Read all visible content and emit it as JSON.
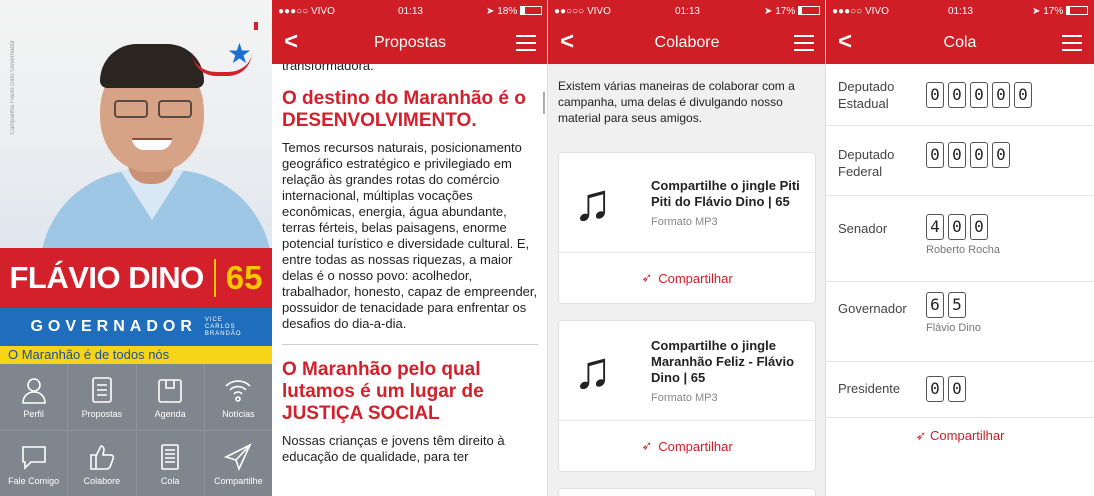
{
  "home": {
    "vertical_note": "Campanha Flávio Dino Governador",
    "name": "FLÁVIO DINO",
    "number": "65",
    "office": "GOVERNADOR",
    "vice_lines": [
      "VICE",
      "CARLOS",
      "BRANDÃO"
    ],
    "slogan": "O Maranhão é de todos nós",
    "menu": [
      {
        "label": "Perfil",
        "icon": "person-icon"
      },
      {
        "label": "Propostas",
        "icon": "document-icon"
      },
      {
        "label": "Agenda",
        "icon": "calendar-icon"
      },
      {
        "label": "Notícias",
        "icon": "wifi-icon"
      },
      {
        "label": "Fale Comigo",
        "icon": "chat-icon"
      },
      {
        "label": "Colabore",
        "icon": "thumbs-up-icon"
      },
      {
        "label": "Cola",
        "icon": "list-icon"
      },
      {
        "label": "Compartilhe",
        "icon": "send-icon"
      }
    ],
    "colors": {
      "red": "#d4202a",
      "yellow": "#f7d417",
      "blue": "#1e6ebd",
      "grid": "#7f868e"
    }
  },
  "propostas": {
    "status": {
      "carrier": "●●●○○ VIVO",
      "time": "01:13",
      "battery": "18%"
    },
    "title": "Propostas",
    "cut_line": "transformadora.",
    "heading1": "O destino do Maranhão é o DESENVOLVIMENTO.",
    "paragraph1": "Temos recursos naturais, posicionamento geográfico estratégico e privilegiado em relação às grandes rotas do comércio internacional, múltiplas vocações econômicas, energia, água abundante, terras férteis, belas paisagens, enorme potencial turístico e diversidade cultural. E, entre todas as nossas riquezas, a maior delas é o nosso povo: acolhedor, trabalhador, honesto, capaz de empreender, possuidor de tenacidade para enfrentar os desafios do dia-a-dia.",
    "heading2": "O Maranhão pelo qual lutamos é um lugar de JUSTIÇA SOCIAL",
    "paragraph2": "Nossas crianças e jovens têm direito à educação de qualidade, para ter"
  },
  "colabore": {
    "status": {
      "carrier": "●●○○○ VIVO",
      "time": "01:13",
      "battery": "17%"
    },
    "title": "Colabore",
    "intro": "Existem várias maneiras de colaborar com a campanha, uma delas é divulgando nosso material para seus amigos.",
    "cards": [
      {
        "title": "Compartilhe o jingle Piti Piti do Flávio Dino | 65",
        "format": "Formato MP3",
        "share": "Compartilhar"
      },
      {
        "title": "Compartilhe o jingle Maranhão Feliz - Flávio Dino | 65",
        "format": "Formato MP3",
        "share": "Compartilhar"
      }
    ]
  },
  "cola": {
    "status": {
      "carrier": "●●●○○ VIVO",
      "time": "01:13",
      "battery": "17%"
    },
    "title": "Cola",
    "rows": [
      {
        "label": "Deputado Estadual",
        "digits": [
          "0",
          "0",
          "0",
          "0",
          "0"
        ],
        "candidate": ""
      },
      {
        "label": "Deputado Federal",
        "digits": [
          "0",
          "0",
          "0",
          "0"
        ],
        "candidate": ""
      },
      {
        "label": "Senador",
        "digits": [
          "4",
          "0",
          "0"
        ],
        "candidate": "Roberto Rocha"
      },
      {
        "label": "Governador",
        "digits": [
          "6",
          "5"
        ],
        "candidate": "Flávio Dino"
      },
      {
        "label": "Presidente",
        "digits": [
          "0",
          "0"
        ],
        "candidate": ""
      }
    ],
    "share": "Compartilhar"
  }
}
